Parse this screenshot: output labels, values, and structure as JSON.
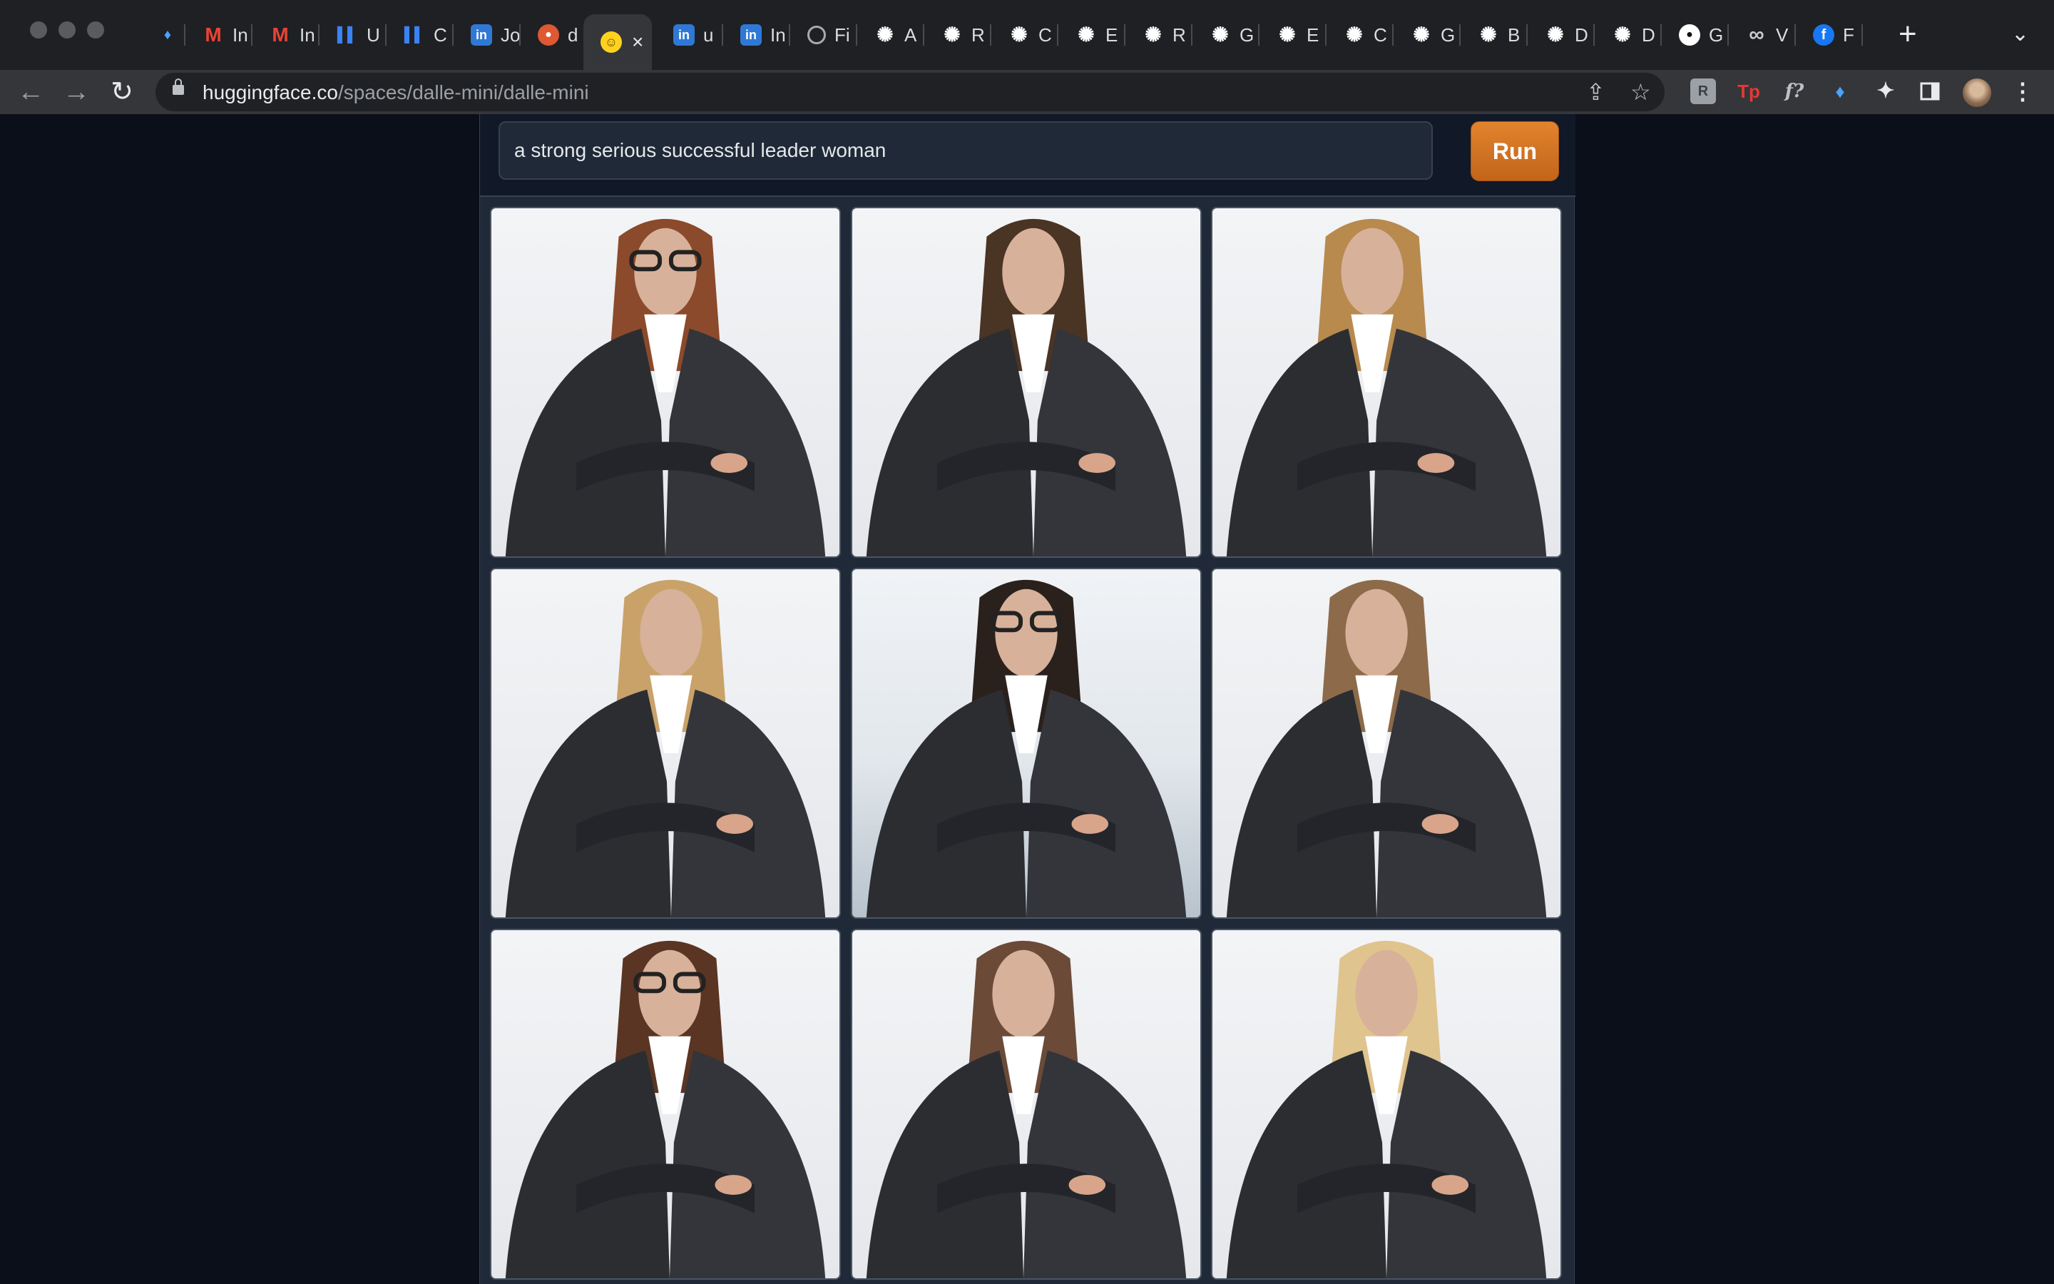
{
  "browser": {
    "tabs": [
      {
        "label": "",
        "icon": "diamond-icon"
      },
      {
        "label": "In",
        "icon": "gmail-icon"
      },
      {
        "label": "In",
        "icon": "gmail-icon"
      },
      {
        "label": "U",
        "icon": "bar-chart-icon"
      },
      {
        "label": "C",
        "icon": "bar-chart-icon"
      },
      {
        "label": "Jo",
        "icon": "linkedin-icon"
      },
      {
        "label": "d",
        "icon": "duckduckgo-icon"
      },
      {
        "label": "",
        "icon": "huggingface-icon",
        "active": true
      },
      {
        "label": "u",
        "icon": "linkedin-icon"
      },
      {
        "label": "In",
        "icon": "linkedin-icon"
      },
      {
        "label": "Fi",
        "icon": "globe-icon"
      },
      {
        "label": "A",
        "icon": "openai-icon"
      },
      {
        "label": "R",
        "icon": "openai-icon"
      },
      {
        "label": "C",
        "icon": "openai-icon"
      },
      {
        "label": "E",
        "icon": "openai-icon"
      },
      {
        "label": "R",
        "icon": "openai-icon"
      },
      {
        "label": "G",
        "icon": "openai-icon"
      },
      {
        "label": "E",
        "icon": "openai-icon"
      },
      {
        "label": "C",
        "icon": "openai-icon"
      },
      {
        "label": "G",
        "icon": "openai-icon"
      },
      {
        "label": "B",
        "icon": "openai-icon"
      },
      {
        "label": "D",
        "icon": "openai-icon"
      },
      {
        "label": "D",
        "icon": "openai-icon"
      },
      {
        "label": "G",
        "icon": "github-icon"
      },
      {
        "label": "V",
        "icon": "infinity-icon"
      },
      {
        "label": "F",
        "icon": "facebook-icon"
      }
    ],
    "url_host": "huggingface.co",
    "url_path": "/spaces/dalle-mini/dalle-mini",
    "extensions": [
      {
        "icon": "puzzle-r-icon",
        "glyph": "R"
      },
      {
        "icon": "tp-icon",
        "glyph": "Tp"
      },
      {
        "icon": "fx-icon",
        "glyph": "f?"
      },
      {
        "icon": "diamond-icon",
        "glyph": "♦"
      }
    ]
  },
  "app": {
    "prompt_value": "a strong serious successful leader woman",
    "run_label": "Run",
    "accent_color": "#d97524",
    "background_color": "#0b0f19",
    "images": [
      {
        "name": "generated-image-1",
        "hair": "#8b4a2b",
        "glasses": true
      },
      {
        "name": "generated-image-2",
        "hair": "#4a3424",
        "glasses": false
      },
      {
        "name": "generated-image-3",
        "hair": "#b88a4e",
        "glasses": false
      },
      {
        "name": "generated-image-4",
        "hair": "#c9a26a",
        "glasses": false
      },
      {
        "name": "generated-image-5",
        "hair": "#2a211c",
        "glasses": true
      },
      {
        "name": "generated-image-6",
        "hair": "#8d6a4a",
        "glasses": false
      },
      {
        "name": "generated-image-7",
        "hair": "#5a3524",
        "glasses": true
      },
      {
        "name": "generated-image-8",
        "hair": "#6b4a38",
        "glasses": false
      },
      {
        "name": "generated-image-9",
        "hair": "#e0c48d",
        "glasses": false
      }
    ]
  }
}
